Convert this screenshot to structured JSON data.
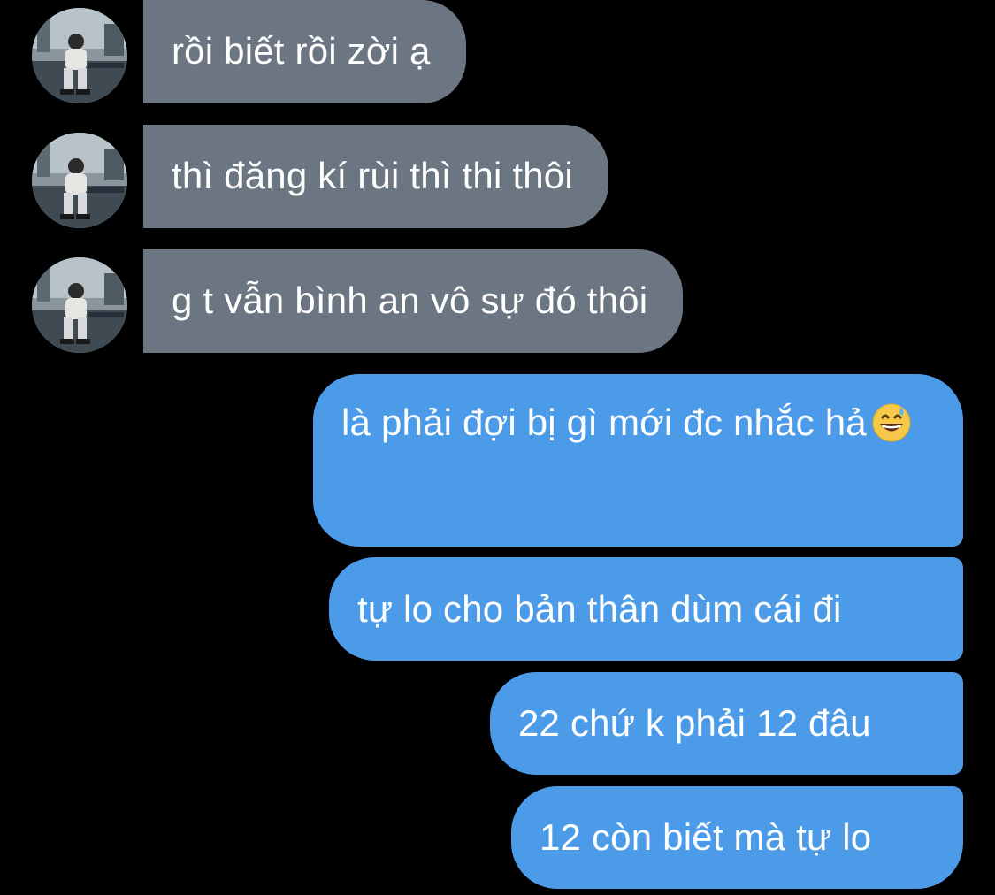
{
  "messages": {
    "incoming": [
      {
        "text": "rồi biết rồi zời ạ"
      },
      {
        "text": "thì đăng kí rùi thì thi thôi"
      },
      {
        "text": "g t vẫn bình an vô sự đó thôi"
      }
    ],
    "outgoing": [
      {
        "text": "là phải đợi bị gì mới đc nhắc hả",
        "emoji": "grinning-face-with-sweat-emoji"
      },
      {
        "text": "tự lo cho bản thân dùm cái đi"
      },
      {
        "text": "22 chứ k phải 12 đâu"
      },
      {
        "text": "12 còn biết mà tự lo"
      }
    ]
  },
  "colors": {
    "background": "#000000",
    "incoming_bubble": "#6b7682",
    "outgoing_bubble": "#4c9be8",
    "text": "#ffffff"
  }
}
